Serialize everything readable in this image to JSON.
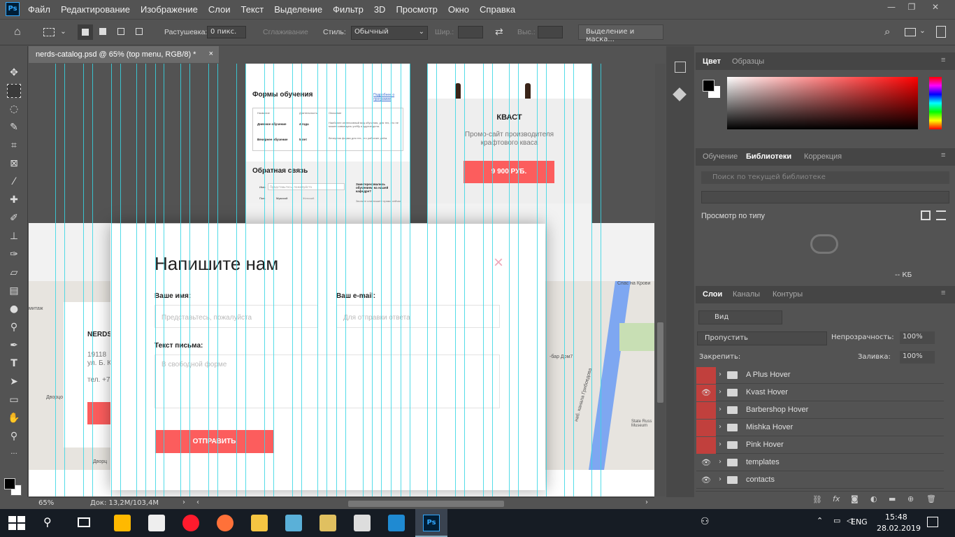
{
  "menubar": {
    "logo": "Ps",
    "items": [
      "Файл",
      "Редактирование",
      "Изображение",
      "Слои",
      "Текст",
      "Выделение",
      "Фильтр",
      "3D",
      "Просмотр",
      "Окно",
      "Справка"
    ]
  },
  "options": {
    "feather_label": "Растушевка:",
    "feather_value": "0 пикс.",
    "antialias_label": "Сглаживание",
    "style_label": "Стиль:",
    "style_value": "Обычный",
    "width_label": "Шир.:",
    "height_label": "Выс.:",
    "select_mask_button": "Выделение и маска..."
  },
  "document": {
    "tab_title": "nerds-catalog.psd @ 65% (top menu, RGB/8) *",
    "zoom": "65%",
    "doc_info": "Док: 13,2M/103,4M"
  },
  "canvas": {
    "course": {
      "heading": "Формы обучения",
      "link": "Подробнее о программе",
      "cols": [
        "Название",
        "Длительность",
        "Описание"
      ],
      "rows": [
        [
          "Дневное обучение",
          "4 года",
          "Наиболее интенсивный вид обучения, для тех, кто не может совмещать учёбу и другие дела."
        ],
        [
          "Вечернее обучение",
          "5 лет",
          "Вечерняя форма для тех, кто работает днём."
        ]
      ],
      "feedback": "Обратная связь",
      "name_label": "Имя:",
      "name_value": "Представьтесь, пожалуйста",
      "sex_label": "Пол:",
      "male": "Мужской",
      "female": "Женский",
      "aside": "Заинтересовались обучением на нашей кафедре?",
      "aside_sub": "Звоните или пишите прямо сейчас"
    },
    "project": {
      "title": "КВАСТ",
      "desc1": "Промо-сайт производителя",
      "desc2": "крафтового кваса",
      "price": "9 900 РУБ."
    },
    "modal": {
      "title": "Напишите нам",
      "name_label": "Ваше имя:",
      "name_placeholder": "Представьтесь, пожалуйста",
      "email_label": "Ваш e-mail:",
      "email_placeholder": "Для отправки ответа",
      "message_label": "Текст письма:",
      "message_placeholder": "В свободной форме",
      "submit": "ОТПРАВИТЬ",
      "close": "×"
    },
    "map": {
      "nerds": "NERDS",
      "addr1": "19118",
      "addr2": "ул. Б. К",
      "phone": "тел. +7",
      "street1": "Дворцо",
      "street2": "Дворц",
      "canal": "наб. канала Грибоедова",
      "museum": "State Russ Museum",
      "spas": "Спас на Крови",
      "bar": "-бар Дом7",
      "hermitage": "митаж"
    }
  },
  "panels": {
    "color_tabs": [
      "Цвет",
      "Образцы"
    ],
    "library_tabs": [
      "Обучение",
      "Библиотеки",
      "Коррекция"
    ],
    "library_search": "Поиск по текущей библиотеке",
    "view_by_type": "Просмотр по типу",
    "library_size": "-- КБ",
    "layers_tabs": [
      "Слои",
      "Каналы",
      "Контуры"
    ],
    "filter_kind": "Вид",
    "blend_mode": "Пропустить",
    "opacity_label": "Непрозрачность:",
    "opacity_value": "100%",
    "lock_label": "Закрепить:",
    "fill_label": "Заливка:",
    "fill_value": "100%",
    "layers": [
      {
        "name": "A Plus Hover",
        "visible": false,
        "highlight": true
      },
      {
        "name": "Kvast Hover",
        "visible": true,
        "highlight": true
      },
      {
        "name": "Barbershop Hover",
        "visible": false,
        "highlight": true
      },
      {
        "name": "Mishka Hover",
        "visible": false,
        "highlight": true
      },
      {
        "name": "Pink Hover",
        "visible": false,
        "highlight": true
      },
      {
        "name": "templates",
        "visible": true,
        "highlight": false
      },
      {
        "name": "contacts",
        "visible": true,
        "highlight": false
      }
    ]
  },
  "taskbar": {
    "lang": "ENG",
    "time": "15:48",
    "date": "28.02.2019"
  },
  "colors": {
    "accent": "#fc5d5d",
    "guide": "#36d6e4",
    "layer_highlight": "#c1403d"
  }
}
